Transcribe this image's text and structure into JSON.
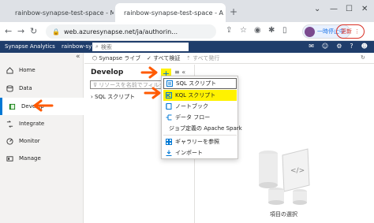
{
  "browser": {
    "tabs": [
      {
        "label": "rainbow-synapse-test-space - M",
        "icon": "azure-icon"
      },
      {
        "label": "rainbow-synapse-test-space - A",
        "icon": "synapse-icon"
      }
    ],
    "new_tab": "+",
    "url": "web.azuresynapse.net/ja/authorin…",
    "pause_label": "一時停止中",
    "update_label": "更新"
  },
  "synapse": {
    "brand": "Synapse Analytics",
    "workspace": "rainbow-synap",
    "search_placeholder": "検索"
  },
  "sidebar": {
    "items": [
      {
        "label": "Home",
        "icon": "home-icon"
      },
      {
        "label": "Data",
        "icon": "data-icon"
      },
      {
        "label": "Develop",
        "icon": "develop-icon"
      },
      {
        "label": "Integrate",
        "icon": "integrate-icon"
      },
      {
        "label": "Monitor",
        "icon": "monitor-icon"
      },
      {
        "label": "Manage",
        "icon": "manage-icon"
      }
    ]
  },
  "toolbar": {
    "live": "Synapse ライブ",
    "validate_all": "すべて検証",
    "publish_all": "すべて発行"
  },
  "develop": {
    "title": "Develop",
    "plus": "+",
    "filter_placeholder": "リソースを名前でフィルター",
    "tree_item": "SQL スクリプト"
  },
  "menu": {
    "items": [
      {
        "label": "SQL スクリプト",
        "icon": "sql-script-icon"
      },
      {
        "label": "KQL スクリプト",
        "icon": "kql-script-icon"
      },
      {
        "label": "ノートブック",
        "icon": "notebook-icon"
      },
      {
        "label": "データ フロー",
        "icon": "dataflow-icon"
      },
      {
        "label": "ジョブ定義の Apache Spark",
        "icon": "spark-job-icon"
      },
      {
        "label": "ギャラリーを参照",
        "icon": "gallery-icon"
      },
      {
        "label": "インポート",
        "icon": "import-icon"
      }
    ]
  },
  "empty_state": {
    "label": "項目の選択"
  },
  "colors": {
    "highlight": "#fff200",
    "accent": "#0078d4",
    "annotation": "#ff5a00",
    "synapse_bar": "#1f3d6b"
  }
}
